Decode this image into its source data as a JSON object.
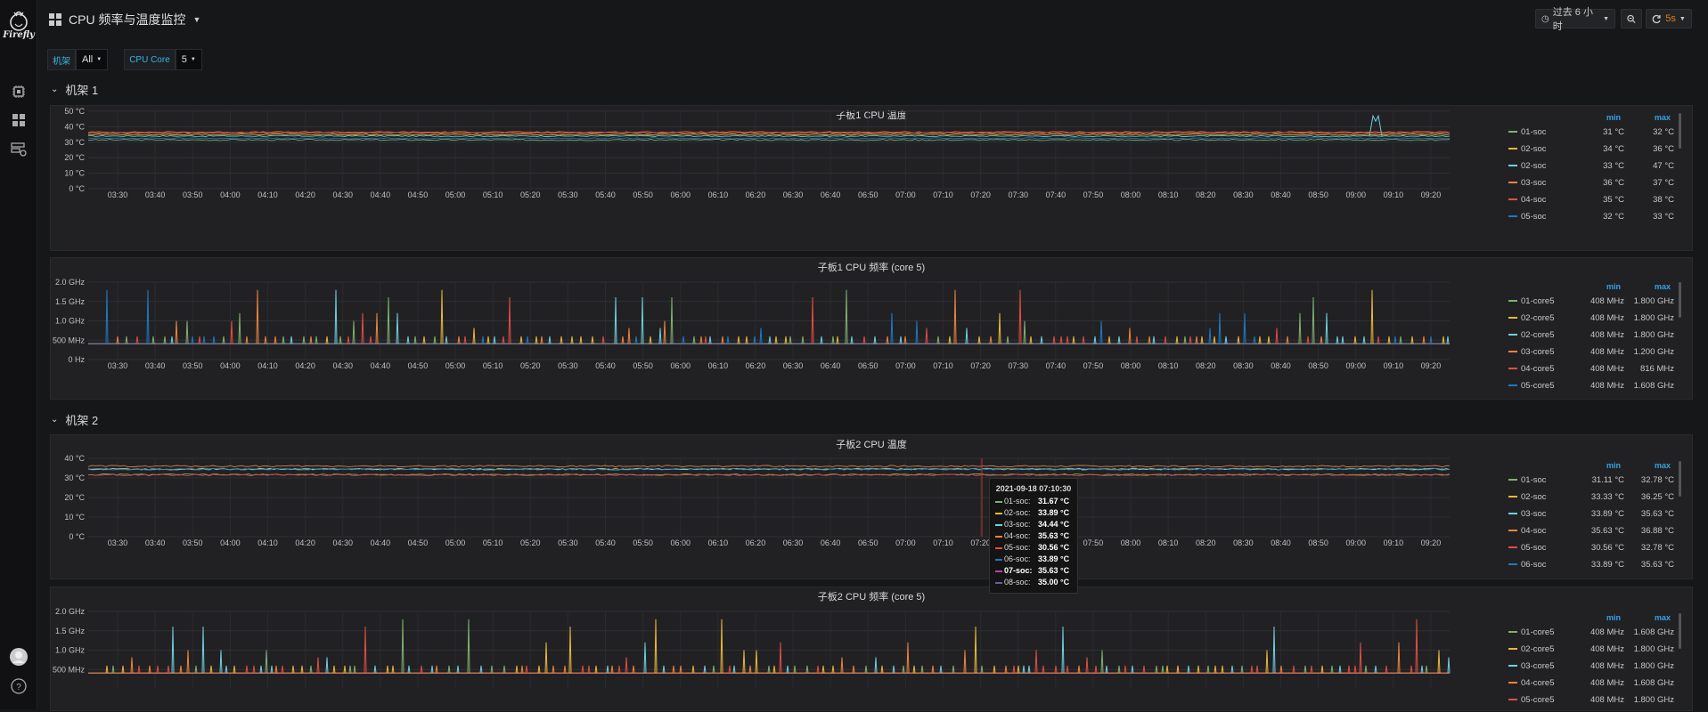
{
  "sidebar": {
    "logo_text": "Firefly",
    "icons": [
      "chip-icon",
      "dashboard-grid-icon",
      "server-settings-icon"
    ],
    "bottom_icons": [
      "user-avatar-icon",
      "help-icon"
    ]
  },
  "topbar": {
    "dashboard_title": "CPU 频率与温度监控",
    "time_range": "过去 6 小时",
    "refresh_interval": "5s"
  },
  "variables": [
    {
      "label": "机架",
      "value": "All"
    },
    {
      "label": "CPU Core",
      "value": "5"
    }
  ],
  "rows": [
    {
      "title": "机架 1"
    },
    {
      "title": "机架 2"
    }
  ],
  "colors": {
    "series": [
      "#7eb26d",
      "#eab839",
      "#6ed0e0",
      "#ef843c",
      "#e24d42",
      "#1f78c1",
      "#ba43a9",
      "#705da0"
    ],
    "accent": "#33a2e5",
    "background": "#161719",
    "panel": "#212124"
  },
  "x_ticks": [
    "03:30",
    "03:40",
    "03:50",
    "04:00",
    "04:10",
    "04:20",
    "04:30",
    "04:40",
    "04:50",
    "05:00",
    "05:10",
    "05:20",
    "05:30",
    "05:40",
    "05:50",
    "06:00",
    "06:10",
    "06:20",
    "06:30",
    "06:40",
    "06:50",
    "07:00",
    "07:10",
    "07:20",
    "07:30",
    "07:40",
    "07:50",
    "08:00",
    "08:10",
    "08:20",
    "08:30",
    "08:40",
    "08:50",
    "09:00",
    "09:10",
    "09:20"
  ],
  "panels": [
    {
      "title": "子板1 CPU 温度",
      "unit": "°C",
      "y_ticks": [
        "50 °C",
        "40 °C",
        "30 °C",
        "20 °C",
        "10 °C",
        "0 °C"
      ],
      "legend_headers": {
        "min": "min",
        "max": "max"
      },
      "legend": [
        {
          "name": "01-soc",
          "min": "31 °C",
          "max": "32 °C"
        },
        {
          "name": "02-soc",
          "min": "34 °C",
          "max": "36 °C"
        },
        {
          "name": "02-soc",
          "min": "33 °C",
          "max": "47 °C"
        },
        {
          "name": "03-soc",
          "min": "36 °C",
          "max": "37 °C"
        },
        {
          "name": "04-soc",
          "min": "35 °C",
          "max": "38 °C"
        },
        {
          "name": "05-soc",
          "min": "32 °C",
          "max": "33 °C"
        }
      ]
    },
    {
      "title": "子板1 CPU 频率 (core 5)",
      "unit": "GHz",
      "y_ticks": [
        "2.0 GHz",
        "1.5 GHz",
        "1.0 GHz",
        "500 MHz",
        "0 Hz"
      ],
      "legend_headers": {
        "min": "min",
        "max": "max"
      },
      "legend": [
        {
          "name": "01-core5",
          "min": "408 MHz",
          "max": "1.800 GHz"
        },
        {
          "name": "02-core5",
          "min": "408 MHz",
          "max": "1.800 GHz"
        },
        {
          "name": "02-core5",
          "min": "408 MHz",
          "max": "1.800 GHz"
        },
        {
          "name": "03-core5",
          "min": "408 MHz",
          "max": "1.200 GHz"
        },
        {
          "name": "04-core5",
          "min": "408 MHz",
          "max": "816 MHz"
        },
        {
          "name": "05-core5",
          "min": "408 MHz",
          "max": "1.608 GHz"
        }
      ]
    },
    {
      "title": "子板2 CPU 温度",
      "unit": "°C",
      "y_ticks": [
        "40 °C",
        "30 °C",
        "20 °C",
        "10 °C",
        "0 °C"
      ],
      "legend_headers": {
        "min": "min",
        "max": "max"
      },
      "legend": [
        {
          "name": "01-soc",
          "min": "31.11 °C",
          "max": "32.78 °C"
        },
        {
          "name": "02-soc",
          "min": "33.33 °C",
          "max": "36.25 °C"
        },
        {
          "name": "03-soc",
          "min": "33.89 °C",
          "max": "35.63 °C"
        },
        {
          "name": "04-soc",
          "min": "35.63 °C",
          "max": "36.88 °C"
        },
        {
          "name": "05-soc",
          "min": "30.56 °C",
          "max": "32.78 °C"
        },
        {
          "name": "06-soc",
          "min": "33.89 °C",
          "max": "35.63 °C"
        }
      ]
    },
    {
      "title": "子板2 CPU 频率 (core 5)",
      "unit": "GHz",
      "y_ticks": [
        "2.0 GHz",
        "1.5 GHz",
        "1.0 GHz",
        "500 MHz"
      ],
      "legend_headers": {
        "min": "min",
        "max": "max"
      },
      "legend": [
        {
          "name": "01-core5",
          "min": "408 MHz",
          "max": "1.608 GHz"
        },
        {
          "name": "02-core5",
          "min": "408 MHz",
          "max": "1.800 GHz"
        },
        {
          "name": "03-core5",
          "min": "408 MHz",
          "max": "1.800 GHz"
        },
        {
          "name": "04-core5",
          "min": "408 MHz",
          "max": "1.608 GHz"
        },
        {
          "name": "05-core5",
          "min": "408 MHz",
          "max": "1.800 GHz"
        }
      ]
    }
  ],
  "tooltip": {
    "time": "2021-09-18 07:10:30",
    "rows": [
      {
        "name": "01-soc:",
        "value": "31.67 °C"
      },
      {
        "name": "02-soc:",
        "value": "33.89 °C"
      },
      {
        "name": "03-soc:",
        "value": "34.44 °C"
      },
      {
        "name": "04-soc:",
        "value": "35.63 °C"
      },
      {
        "name": "05-soc:",
        "value": "30.56 °C"
      },
      {
        "name": "06-soc:",
        "value": "33.89 °C"
      },
      {
        "name": "07-soc:",
        "value": "35.63 °C"
      },
      {
        "name": "08-soc:",
        "value": "35.00 °C"
      }
    ]
  },
  "chart_data": [
    {
      "type": "line",
      "title": "子板1 CPU 温度",
      "x_range": [
        "03:25",
        "09:25"
      ],
      "ylim": [
        0,
        50
      ],
      "legend_placement": "right",
      "grid": true,
      "series": [
        {
          "name": "01-soc",
          "level": 31.5
        },
        {
          "name": "02-soc",
          "level": 35
        },
        {
          "name": "02-soc",
          "level": 34,
          "spike_time": "09:03",
          "spike_value": 47
        },
        {
          "name": "03-soc",
          "level": 36.5
        },
        {
          "name": "04-soc",
          "level": 36
        },
        {
          "name": "05-soc",
          "level": 32.5
        }
      ]
    },
    {
      "type": "line",
      "title": "子板1 CPU 频率 (core 5)",
      "x_range": [
        "03:25",
        "09:25"
      ],
      "ylim": [
        0,
        2.0
      ],
      "baseline_ghz": 0.408,
      "max_ghz": 1.8,
      "legend_placement": "right",
      "grid": true
    },
    {
      "type": "line",
      "title": "子板2 CPU 温度",
      "x_range": [
        "03:25",
        "09:25"
      ],
      "ylim": [
        0,
        40
      ],
      "legend_placement": "right",
      "grid": true,
      "series": [
        {
          "name": "01-soc",
          "level": 31.7
        },
        {
          "name": "02-soc",
          "level": 34.5
        },
        {
          "name": "03-soc",
          "level": 34.5
        },
        {
          "name": "04-soc",
          "level": 36
        },
        {
          "name": "05-soc",
          "level": 31.5
        },
        {
          "name": "06-soc",
          "level": 34.5
        }
      ]
    },
    {
      "type": "line",
      "title": "子板2 CPU 频率 (core 5)",
      "x_range": [
        "03:25",
        "09:25"
      ],
      "ylim": [
        0,
        2.0
      ],
      "baseline_ghz": 0.408,
      "max_ghz": 1.8,
      "legend_placement": "right",
      "grid": true
    }
  ]
}
